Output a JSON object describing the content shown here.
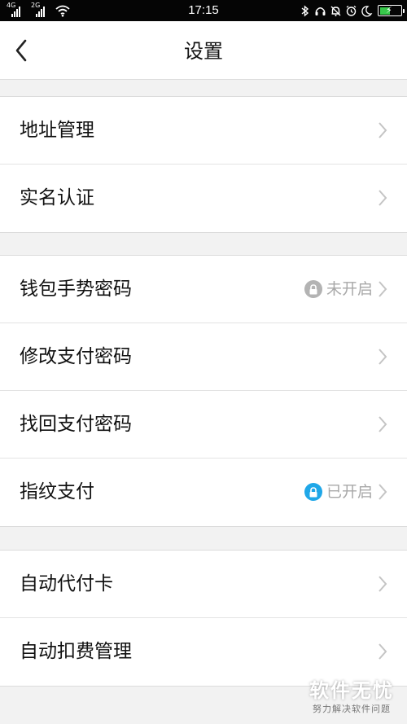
{
  "status_bar": {
    "time": "17:15",
    "signal_1_tag": "4G",
    "signal_2_tag": "2G",
    "icons": [
      "signal-icon",
      "signal-icon",
      "wifi-icon",
      "bluetooth-icon",
      "headset-icon",
      "alarm-bell-icon",
      "alarm-clock-icon",
      "moon-icon",
      "battery-icon"
    ],
    "battery_level": 0.55
  },
  "nav": {
    "back_icon": "chevron-left-icon",
    "title": "设置"
  },
  "groups": [
    {
      "items": [
        {
          "label": "地址管理"
        },
        {
          "label": "实名认证"
        }
      ]
    },
    {
      "items": [
        {
          "label": "钱包手势密码",
          "status": "未开启",
          "status_icon": "lock-icon",
          "status_color": "#b3b3b3"
        },
        {
          "label": "修改支付密码"
        },
        {
          "label": "找回支付密码"
        },
        {
          "label": "指纹支付",
          "status": "已开启",
          "status_icon": "lock-icon",
          "status_color": "#1fa7e8"
        }
      ]
    },
    {
      "items": [
        {
          "label": "自动代付卡"
        },
        {
          "label": "自动扣费管理"
        }
      ]
    }
  ],
  "watermark": {
    "title": "软件无忧",
    "subtitle": "努力解决软件问题"
  },
  "colors": {
    "background": "#f2f2f2",
    "row_background": "#ffffff",
    "chevron": "#c4c4c4",
    "status_text": "#a8a8a8"
  }
}
